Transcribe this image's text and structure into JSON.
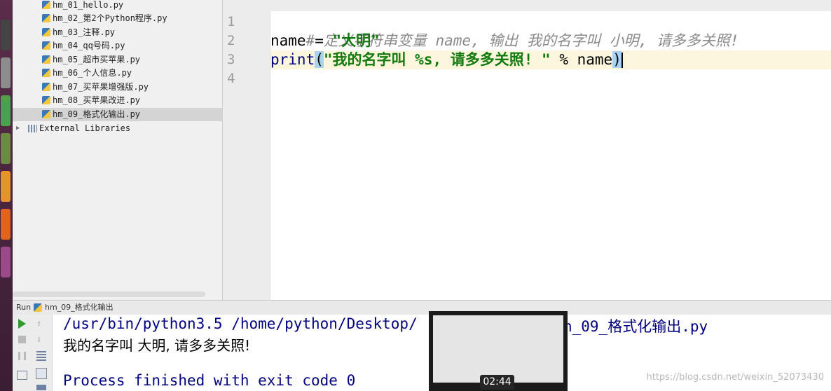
{
  "project_tree": {
    "files": [
      {
        "name": "hm_01_hello.py",
        "selected": false
      },
      {
        "name": "hm_02_第2个Python程序.py",
        "selected": false
      },
      {
        "name": "hm_03_注释.py",
        "selected": false
      },
      {
        "name": "hm_04_qq号码.py",
        "selected": false
      },
      {
        "name": "hm_05_超市买苹果.py",
        "selected": false
      },
      {
        "name": "hm_06_个人信息.py",
        "selected": false
      },
      {
        "name": "hm_07_买苹果增强版.py",
        "selected": false
      },
      {
        "name": "hm_08_买苹果改进.py",
        "selected": false
      },
      {
        "name": "hm_09_格式化输出.py",
        "selected": true
      }
    ],
    "external_libraries": "External Libraries"
  },
  "editor": {
    "line_numbers": [
      "1",
      "2",
      "3",
      "4"
    ],
    "current_line": 3,
    "lines": {
      "l1_comment": "# 定义字符串变量 name, 输出 我的名字叫 小明, 请多多关照!",
      "l2_var": "name = ",
      "l2_str": "\"大明\"",
      "l3_print": "print",
      "l3_open": "(",
      "l3_str": "\"我的名字叫 %s, 请多多关照! \"",
      "l3_rest": " % name",
      "l3_close": ")"
    }
  },
  "run_panel": {
    "label": "Run",
    "config_name": "hm_09_格式化输出",
    "console": {
      "cmd_left": "/usr/bin/python3.5 /home/python/Desktop/",
      "cmd_right": "n_09_格式化输出.py",
      "output": "我的名字叫 大明, 请多多关照!",
      "exit": "Process finished with exit code 0"
    }
  },
  "video_overlay": {
    "timestamp": "02:44"
  },
  "watermark": "https://blog.csdn.net/weixin_52073430",
  "colors": {
    "string": "#127a0e",
    "comment": "#8a8a8a",
    "console_text": "#000080",
    "current_line": "#fbf6dc",
    "brace_match": "#a9d2f5"
  }
}
